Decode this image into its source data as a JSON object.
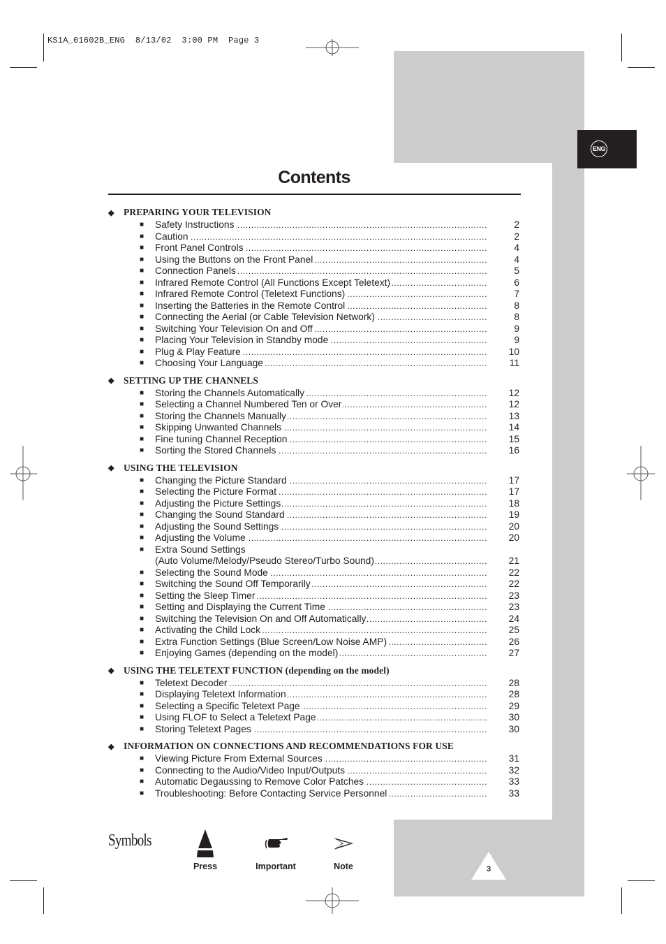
{
  "slug": "KS1A_01602B_ENG  8/13/02  3:00 PM  Page 3",
  "language_tab": "ENG",
  "title": "Contents",
  "sections": [
    {
      "heading": "PREPARING YOUR TELEVISION",
      "heading_suffix": "",
      "items": [
        {
          "label": "Safety Instructions",
          "page": "2"
        },
        {
          "label": "Caution",
          "page": "2"
        },
        {
          "label": "Front Panel Controls",
          "page": "4"
        },
        {
          "label": "Using the Buttons on the Front Panel",
          "page": "4"
        },
        {
          "label": "Connection Panels",
          "page": "5"
        },
        {
          "label": "Infrared Remote Control (All Functions Except Teletext)",
          "page": "6"
        },
        {
          "label": "Infrared Remote Control (Teletext Functions)",
          "page": "7"
        },
        {
          "label": "Inserting the Batteries in the Remote Control",
          "page": "8"
        },
        {
          "label": "Connecting the Aerial (or Cable Television Network)",
          "page": "8"
        },
        {
          "label": "Switching Your Television On and Off",
          "page": "9"
        },
        {
          "label": "Placing Your Television in Standby mode",
          "page": "9"
        },
        {
          "label": "Plug & Play Feature",
          "page": "10"
        },
        {
          "label": "Choosing Your Language",
          "page": "11"
        }
      ]
    },
    {
      "heading": "SETTING UP THE CHANNELS",
      "heading_suffix": "",
      "items": [
        {
          "label": "Storing the Channels Automatically",
          "page": "12"
        },
        {
          "label": "Selecting a Channel Numbered Ten or Over",
          "page": "12"
        },
        {
          "label": "Storing the Channels Manually",
          "page": "13"
        },
        {
          "label": "Skipping Unwanted Channels",
          "page": "14"
        },
        {
          "label": "Fine tuning Channel Reception",
          "page": "15"
        },
        {
          "label": "Sorting the Stored Channels",
          "page": "16"
        }
      ]
    },
    {
      "heading": "USING THE TELEVISION",
      "heading_suffix": "",
      "items": [
        {
          "label": "Changing the Picture Standard",
          "page": "17"
        },
        {
          "label": "Selecting the Picture Format",
          "page": "17"
        },
        {
          "label": "Adjusting the Picture Settings",
          "page": "18"
        },
        {
          "label": "Changing the Sound Standard",
          "page": "19"
        },
        {
          "label": "Adjusting the Sound Settings",
          "page": "20"
        },
        {
          "label": "Adjusting the Volume",
          "page": "20"
        },
        {
          "label": "Extra Sound Settings",
          "label2": "(Auto Volume/Melody/Pseudo Stereo/Turbo Sound)",
          "page": "21"
        },
        {
          "label": "Selecting the Sound Mode",
          "page": "22"
        },
        {
          "label": "Switching the Sound Off Temporarily",
          "page": "22"
        },
        {
          "label": "Setting the Sleep Timer",
          "page": "23"
        },
        {
          "label": "Setting and Displaying the Current Time",
          "page": "23"
        },
        {
          "label": "Switching the Television On and Off Automatically",
          "page": "24"
        },
        {
          "label": "Activating the Child Lock",
          "page": "25"
        },
        {
          "label": "Extra Function Settings (Blue Screen/Low Noise AMP)",
          "page": "26"
        },
        {
          "label": "Enjoying Games (depending on the model)",
          "page": "27"
        }
      ]
    },
    {
      "heading": "USING THE TELETEXT FUNCTION",
      "heading_suffix": " (depending on the model)",
      "items": [
        {
          "label": "Teletext Decoder",
          "page": "28"
        },
        {
          "label": "Displaying Teletext Information",
          "page": "28"
        },
        {
          "label": "Selecting a Specific Teletext Page",
          "page": "29"
        },
        {
          "label": "Using FLOF to Select a Teletext Page",
          "page": "30"
        },
        {
          "label": "Storing Teletext Pages",
          "page": "30"
        }
      ]
    },
    {
      "heading": "INFORMATION ON CONNECTIONS AND RECOMMENDATIONS FOR USE",
      "heading_suffix": "",
      "items": [
        {
          "label": "Viewing Picture From External Sources",
          "page": "31"
        },
        {
          "label": "Connecting to the Audio/Video Input/Outputs",
          "page": "32"
        },
        {
          "label": "Automatic Degaussing to Remove Color Patches",
          "page": "33"
        },
        {
          "label": "Troubleshooting: Before Contacting Service Personnel",
          "page": "33"
        }
      ]
    }
  ],
  "symbols": {
    "title": "Symbols",
    "items": [
      {
        "icon": "press-icon",
        "label": "Press"
      },
      {
        "icon": "important-hand-icon",
        "label": "Important"
      },
      {
        "icon": "note-arrow-icon",
        "label": "Note"
      }
    ]
  },
  "page_number": "3",
  "colors": {
    "ink": "#231f20",
    "panel_grey": "#cccccc",
    "tab_black": "#231f20"
  }
}
